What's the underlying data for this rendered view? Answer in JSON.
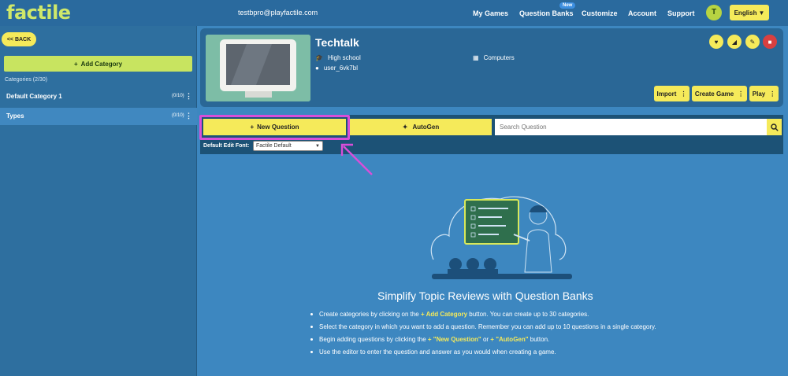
{
  "header": {
    "logo": "factile",
    "email": "testbpro@playfactile.com",
    "nav": [
      "My Games",
      "Question Banks",
      "Customize",
      "Account",
      "Support"
    ],
    "new_badge": "New",
    "avatar_initial": "T",
    "language": "English"
  },
  "sidebar": {
    "back_label": "<< BACK",
    "add_category_label": "Add Category",
    "categories_count": "Categories (2/30)",
    "categories": [
      {
        "name": "Default Category 1",
        "count": "(0/10)"
      },
      {
        "name": "Types",
        "count": "(0/10)"
      }
    ]
  },
  "bank": {
    "title": "Techtalk",
    "level": "High school",
    "subject": "Computers",
    "user": "user_6vk7bl",
    "actions": [
      "Import",
      "Create Game",
      "Play"
    ]
  },
  "toolbar": {
    "new_question_label": "New Question",
    "autogen_label": "AutoGen",
    "search_placeholder": "Search Question",
    "font_label": "Default Edit Font:",
    "font_value": "Factile Default"
  },
  "empty_state": {
    "headline": "Simplify Topic Reviews with Question Banks",
    "bullet1_pre": "Create categories by clicking on the ",
    "bullet1_hl": "Add Category",
    "bullet1_post": " button. You can create up to 30 categories.",
    "bullet2": "Select the category in which you want to add a question. Remember you can add up to 10 questions in a single category.",
    "bullet3_pre": "Begin adding questions by clicking the ",
    "bullet3_hl1": "\"New Question\"",
    "bullet3_mid": " or ",
    "bullet3_hl2": "\"AutoGen\"",
    "bullet3_post": " button.",
    "bullet4": "Use the editor to enter the question and answer as you would when creating a game."
  },
  "colors": {
    "yellow": "#f5ea5a",
    "green": "#c8e460",
    "highlight": "#d94ed9",
    "background": "#3d87c0"
  }
}
